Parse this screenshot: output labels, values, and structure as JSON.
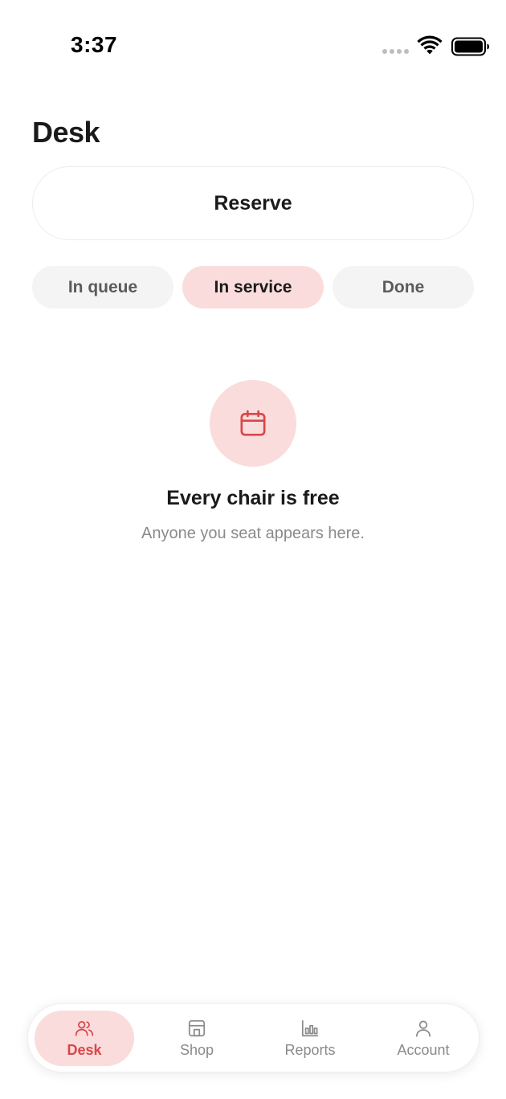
{
  "status_bar": {
    "time": "3:37"
  },
  "header": {
    "title": "Desk"
  },
  "reserve_button": {
    "label": "Reserve"
  },
  "tabs": [
    {
      "label": "In queue",
      "active": false
    },
    {
      "label": "In service",
      "active": true
    },
    {
      "label": "Done",
      "active": false
    }
  ],
  "empty_state": {
    "icon": "calendar-icon",
    "title": "Every chair is free",
    "subtitle": "Anyone you seat appears here."
  },
  "bottom_nav": {
    "items": [
      {
        "label": "Desk",
        "icon": "people-icon",
        "active": true
      },
      {
        "label": "Shop",
        "icon": "storefront-icon",
        "active": false
      },
      {
        "label": "Reports",
        "icon": "bar-chart-icon",
        "active": false
      },
      {
        "label": "Account",
        "icon": "person-icon",
        "active": false
      }
    ]
  },
  "colors": {
    "accent": "#d9464a",
    "accent_soft": "#fadcdc",
    "tab_inactive_bg": "#f4f4f4",
    "text_primary": "#1a1a1a",
    "text_muted": "#8a8a8a"
  }
}
